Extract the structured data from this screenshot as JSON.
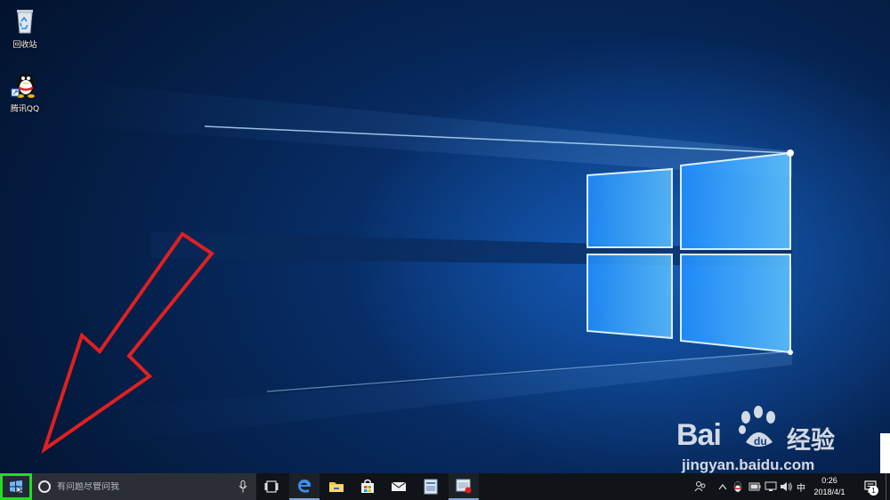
{
  "desktop": {
    "icons": [
      {
        "label": "回收站",
        "icon": "recycle-bin-icon"
      },
      {
        "label": "腾讯QQ",
        "icon": "qq-penguin-icon"
      }
    ]
  },
  "watermark": {
    "brand": "Bai",
    "brand_cn": "经验",
    "url": "jingyan.baidu.com"
  },
  "taskbar": {
    "start_icon": "windows-logo-icon",
    "search_placeholder": "有问题尽管问我",
    "pinned": [
      {
        "name": "task-view",
        "icon": "task-view-icon"
      },
      {
        "name": "edge",
        "icon": "edge-icon"
      },
      {
        "name": "file-explorer",
        "icon": "folder-icon"
      },
      {
        "name": "store",
        "icon": "store-bag-icon"
      },
      {
        "name": "mail",
        "icon": "mail-icon"
      },
      {
        "name": "app-1",
        "icon": "app-window-icon"
      },
      {
        "name": "app-2",
        "icon": "app-window-red-icon"
      }
    ],
    "tray": {
      "ime_label": "中",
      "time": "0:26",
      "date": "2018/4/1",
      "notification_count": "1"
    }
  },
  "colors": {
    "start_highlight": "#22dd22",
    "annotation_arrow": "#e02020",
    "wallpaper_glow": "#58b8ff"
  }
}
